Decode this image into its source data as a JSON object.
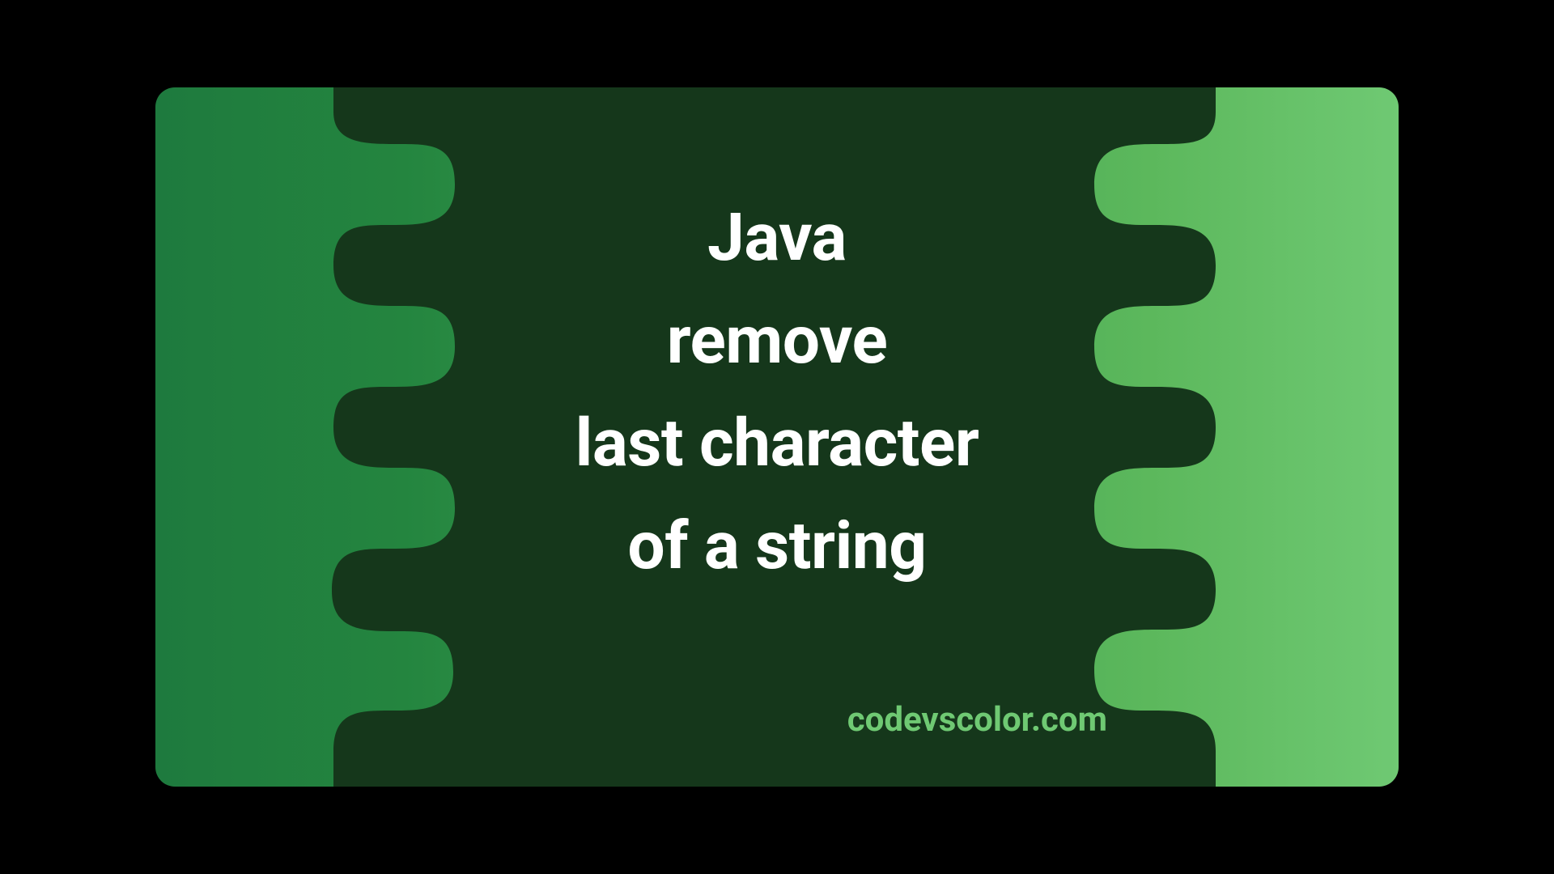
{
  "title": {
    "line1": "Java",
    "line2": "remove",
    "line3": "last character",
    "line4": "of a string"
  },
  "footer": "codevscolor.com",
  "colors": {
    "darkBlob": "#15371b",
    "gradientStart": "#1e7a3e",
    "gradientEnd": "#6fc973",
    "text": "#ffffff",
    "footerText": "#6fc973"
  }
}
